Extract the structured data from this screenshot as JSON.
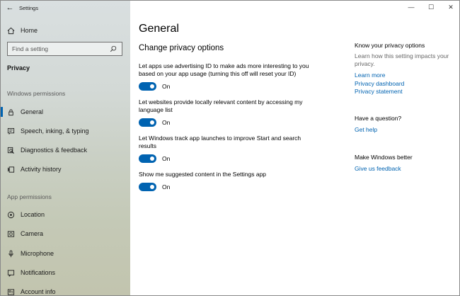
{
  "app_title": "Settings",
  "window_controls": {
    "minimize": "—",
    "maximize": "☐",
    "close": "✕"
  },
  "sidebar": {
    "home_label": "Home",
    "search_placeholder": "Find a setting",
    "section_label": "Privacy",
    "windows_permissions_head": "Windows permissions",
    "windows_permissions": [
      {
        "label": "General",
        "icon": "lock-icon",
        "selected": true
      },
      {
        "label": "Speech, inking, & typing",
        "icon": "speech-icon"
      },
      {
        "label": "Diagnostics & feedback",
        "icon": "diagnostics-icon"
      },
      {
        "label": "Activity history",
        "icon": "activity-history-icon"
      }
    ],
    "app_permissions_head": "App permissions",
    "app_permissions": [
      {
        "label": "Location",
        "icon": "location-icon"
      },
      {
        "label": "Camera",
        "icon": "camera-icon"
      },
      {
        "label": "Microphone",
        "icon": "microphone-icon"
      },
      {
        "label": "Notifications",
        "icon": "notifications-icon"
      },
      {
        "label": "Account info",
        "icon": "account-info-icon"
      }
    ]
  },
  "main": {
    "title": "General",
    "subtitle": "Change privacy options",
    "settings": [
      {
        "desc": "Let apps use advertising ID to make ads more interesting to you based on your app usage (turning this off will reset your ID)",
        "state": "On"
      },
      {
        "desc": "Let websites provide locally relevant content by accessing my language list",
        "state": "On"
      },
      {
        "desc": "Let Windows track app launches to improve Start and search results",
        "state": "On"
      },
      {
        "desc": "Show me suggested content in the Settings app",
        "state": "On"
      }
    ]
  },
  "aside": {
    "know_head": "Know your privacy options",
    "know_text": "Learn how this setting impacts your privacy.",
    "links": [
      "Learn more",
      "Privacy dashboard",
      "Privacy statement"
    ],
    "question_head": "Have a question?",
    "help_link": "Get help",
    "better_head": "Make Windows better",
    "feedback_link": "Give us feedback"
  },
  "colors": {
    "accent": "#0063b1",
    "sidebar_bg": "#cfd5cf"
  }
}
